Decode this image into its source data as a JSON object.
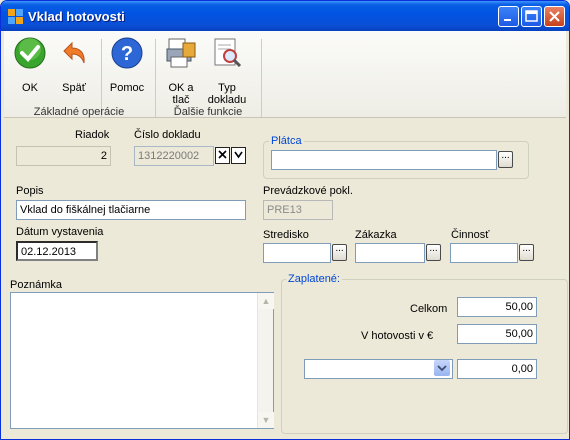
{
  "window": {
    "title": "Vklad hotovosti"
  },
  "ribbon": {
    "ok_label": "OK",
    "back_label": "Späť",
    "help_label": "Pomoc",
    "group1_label": "Základné operácie",
    "ok_print_label": "OK a tlač",
    "doc_type_label": "Typ dokladu",
    "group2_label": "Ďalšie funkcie"
  },
  "form": {
    "riadok_label": "Riadok",
    "riadok_value": "2",
    "cislo_label": "Číslo dokladu",
    "cislo_value": "1312220002",
    "platca_label": "Plátca",
    "platca_value": "",
    "popis_label": "Popis",
    "popis_value": "Vklad do fiškálnej tlačiarne",
    "prevadzkove_label": "Prevádzkové pokl.",
    "prevadzkove_value": "PRE13",
    "datum_label": "Dátum vystavenia",
    "datum_value": "02.12.2013",
    "stredisko_label": "Stredisko",
    "zakazka_label": "Zákazka",
    "cinnost_label": "Činnosť",
    "poznamka_label": "Poznámka",
    "zaplatene_label": "Zaplatené:",
    "celkom_label": "Celkom",
    "celkom_value": "50,00",
    "hotovost_label": "V hotovosti v €",
    "hotovost_value": "50,00",
    "currency_value": "",
    "other_value": "0,00"
  }
}
